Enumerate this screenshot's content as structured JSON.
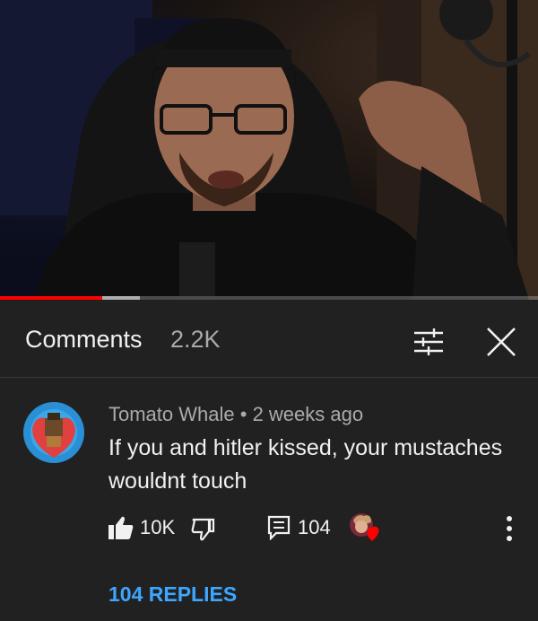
{
  "video": {
    "progress_fraction": 0.19,
    "buffered_fraction": 0.26
  },
  "comments_header": {
    "title": "Comments",
    "count": "2.2K",
    "filter_icon": "sort-filter-icon",
    "close_icon": "close-icon"
  },
  "comment": {
    "author": "Tomato Whale",
    "separator": " • ",
    "age": "2 weeks ago",
    "text": "If you and hitler kissed, your mustaches wouldnt touch",
    "like_count": "10K",
    "reply_count": "104",
    "replies_link": "104 REPLIES",
    "icons": [
      "thumb-up-icon",
      "thumb-down-icon",
      "reply-icon",
      "creator-heart-icon",
      "more-vert-icon"
    ]
  },
  "colors": {
    "background": "#212121",
    "progress_played": "#ff0000",
    "link_blue": "#3ea6ff",
    "secondary_text": "#aaaaaa",
    "heart_red": "#ff0000"
  }
}
